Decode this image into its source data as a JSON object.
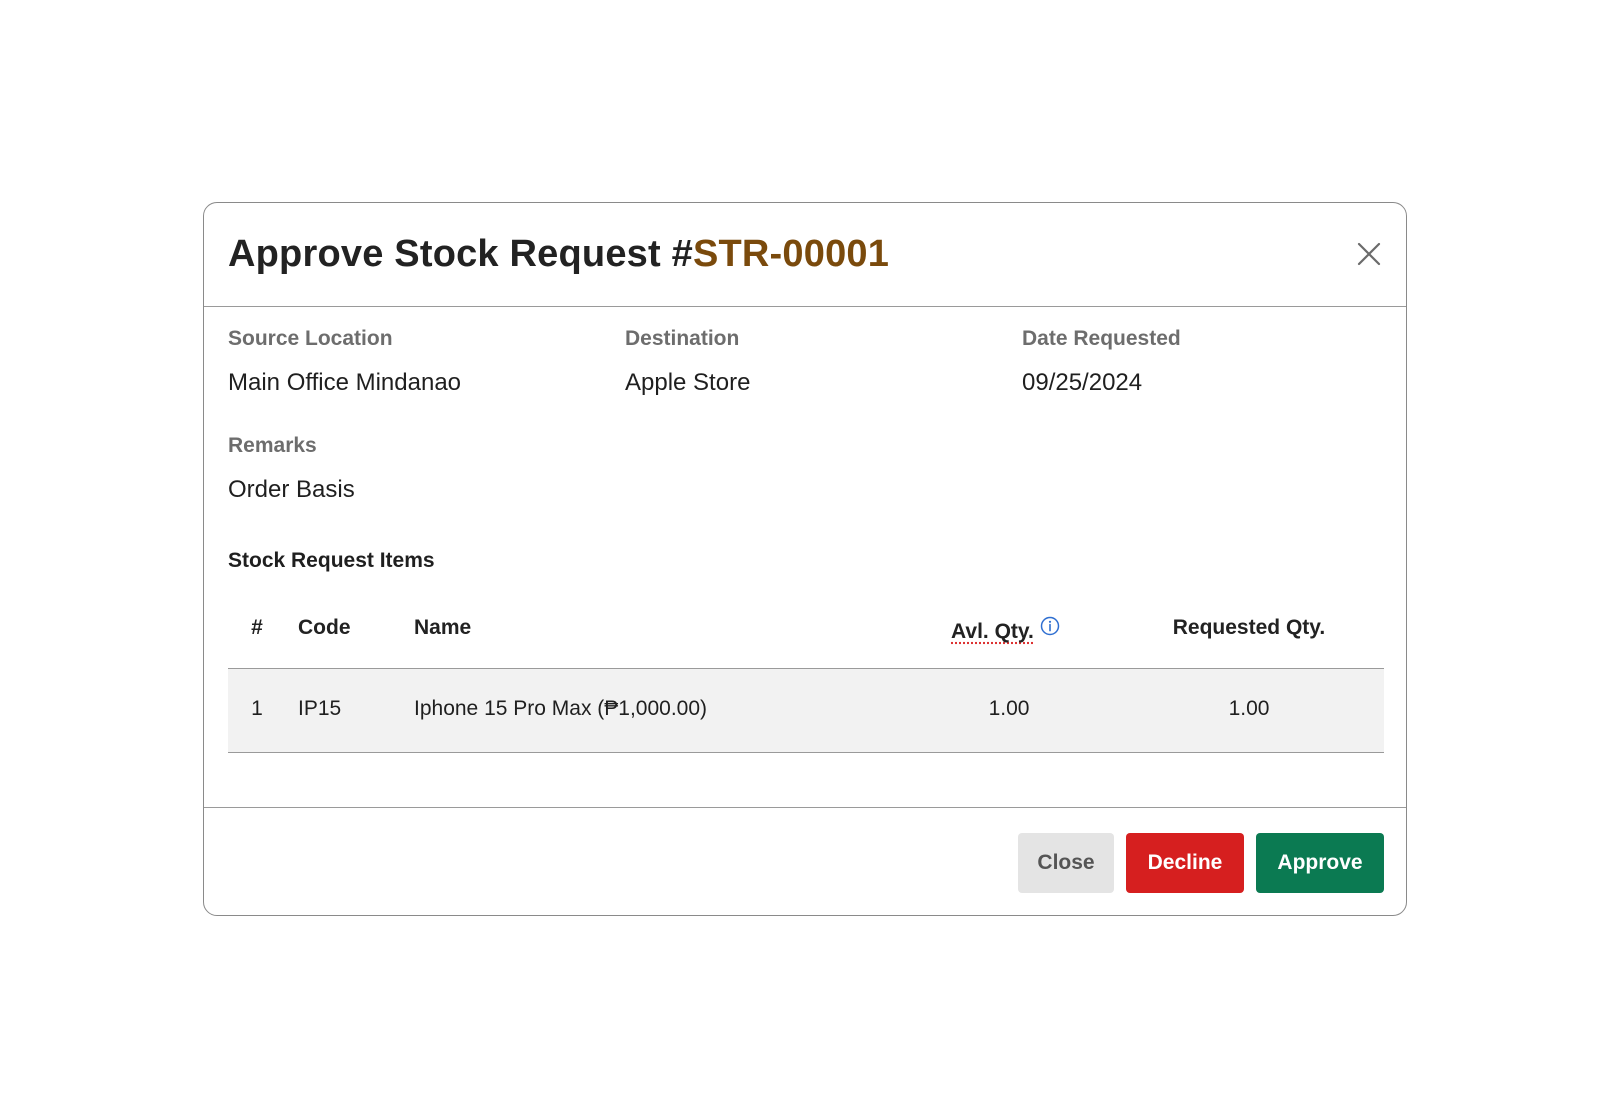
{
  "modal": {
    "title_prefix": "Approve Stock Request #",
    "request_id": "STR-00001",
    "close_icon": "close-icon"
  },
  "details": {
    "source_location_label": "Source Location",
    "source_location_value": "Main Office Mindanao",
    "destination_label": "Destination",
    "destination_value": "Apple Store",
    "date_requested_label": "Date Requested",
    "date_requested_value": "09/25/2024",
    "remarks_label": "Remarks",
    "remarks_value": "Order Basis"
  },
  "items": {
    "section_title": "Stock Request Items",
    "headers": {
      "index": "#",
      "code": "Code",
      "name": "Name",
      "available_qty": "Avl. Qty.",
      "requested_qty": "Requested Qty."
    },
    "info_icon": "info-icon",
    "rows": [
      {
        "index": "1",
        "code": "IP15",
        "name": "Iphone 15 Pro Max (₱1,000.00)",
        "available_qty": "1.00",
        "requested_qty": "1.00"
      }
    ]
  },
  "footer": {
    "close_label": "Close",
    "decline_label": "Decline",
    "approve_label": "Approve"
  },
  "colors": {
    "request_id": "#7a4a0c",
    "decline": "#d61f1f",
    "approve": "#0b7a52",
    "close_button_bg": "#e4e4e4",
    "row_bg": "#f2f2f2",
    "info_icon": "#2f6fd1"
  }
}
